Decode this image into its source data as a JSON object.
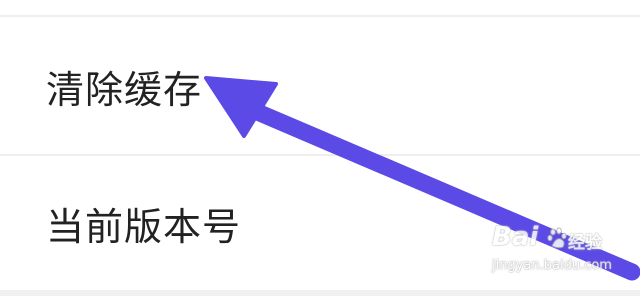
{
  "settings": {
    "items": [
      {
        "label": "清除缓存"
      },
      {
        "label": "当前版本号"
      }
    ]
  },
  "annotation": {
    "arrow_color": "#5b4ae6",
    "arrow_target": "清除缓存"
  },
  "watermark": {
    "brand": "Bai",
    "brand_zh": "经验",
    "url": "jingyan.baidu.com",
    "icon": "baidu-paw-icon"
  },
  "colors": {
    "background": "#ffffff",
    "divider": "#eeeeee",
    "text": "#222222"
  }
}
